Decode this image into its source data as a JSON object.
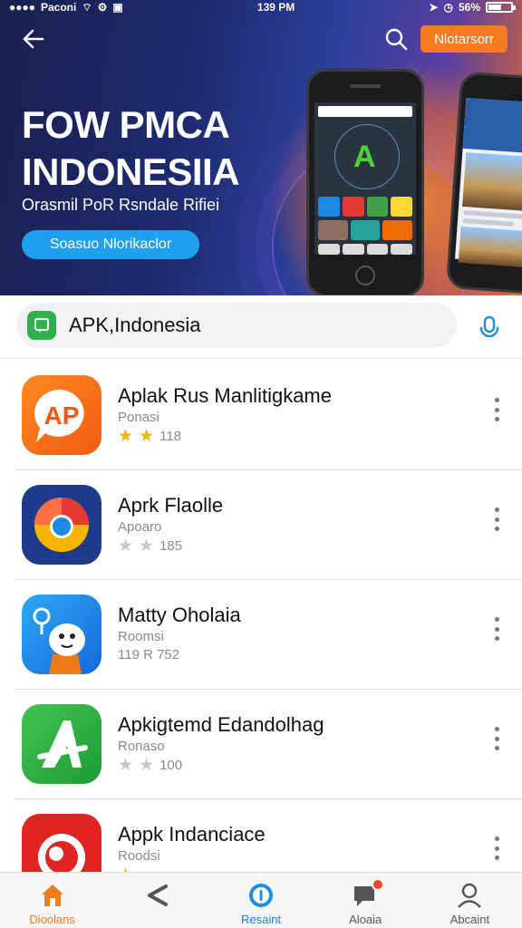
{
  "status_bar": {
    "carrier": "Paconi",
    "time": "139 PM",
    "battery": "56%"
  },
  "header": {
    "top_button": "Nlotarsorr"
  },
  "hero": {
    "title_line1": "FOW PMCA",
    "title_line2": "INDONESIIA",
    "subtitle": "Orasmil PoR Rsndale Rifiei",
    "button": "Soasuo Nlorikaclor"
  },
  "search": {
    "value": "APK,Indonesia"
  },
  "apps": [
    {
      "name": "Aplak Rus Manlitigkame",
      "sub": "Ponasi",
      "stars_on": 2,
      "stars_off": 0,
      "rating_text": "118"
    },
    {
      "name": "Aprk Flaolle",
      "sub": "Apoaro",
      "stars_on": 0,
      "stars_off": 2,
      "rating_text": "185"
    },
    {
      "name": "Matty Oholaia",
      "sub": "Roomsi",
      "stars_on": 0,
      "stars_off": 0,
      "rating_text": "119 R 752"
    },
    {
      "name": "Apkigtemd Edandolhag",
      "sub": "Ronaso",
      "stars_on": 0,
      "stars_off": 2,
      "rating_text": "100"
    },
    {
      "name": "Appk Indanciace",
      "sub": "Roodsi",
      "stars_on": 1,
      "stars_off": 0,
      "rating_text": ""
    }
  ],
  "nav": [
    {
      "label": "Dioolans",
      "icon": "home-icon"
    },
    {
      "label": "",
      "icon": "share-icon"
    },
    {
      "label": "Resaint",
      "icon": "info-circle-icon"
    },
    {
      "label": "Aloaia",
      "icon": "chat-notification-icon"
    },
    {
      "label": "Abcaint",
      "icon": "account-icon"
    }
  ],
  "colors": {
    "accent": "#f47b20",
    "blue": "#1fa0ee",
    "star": "#f5b400"
  }
}
